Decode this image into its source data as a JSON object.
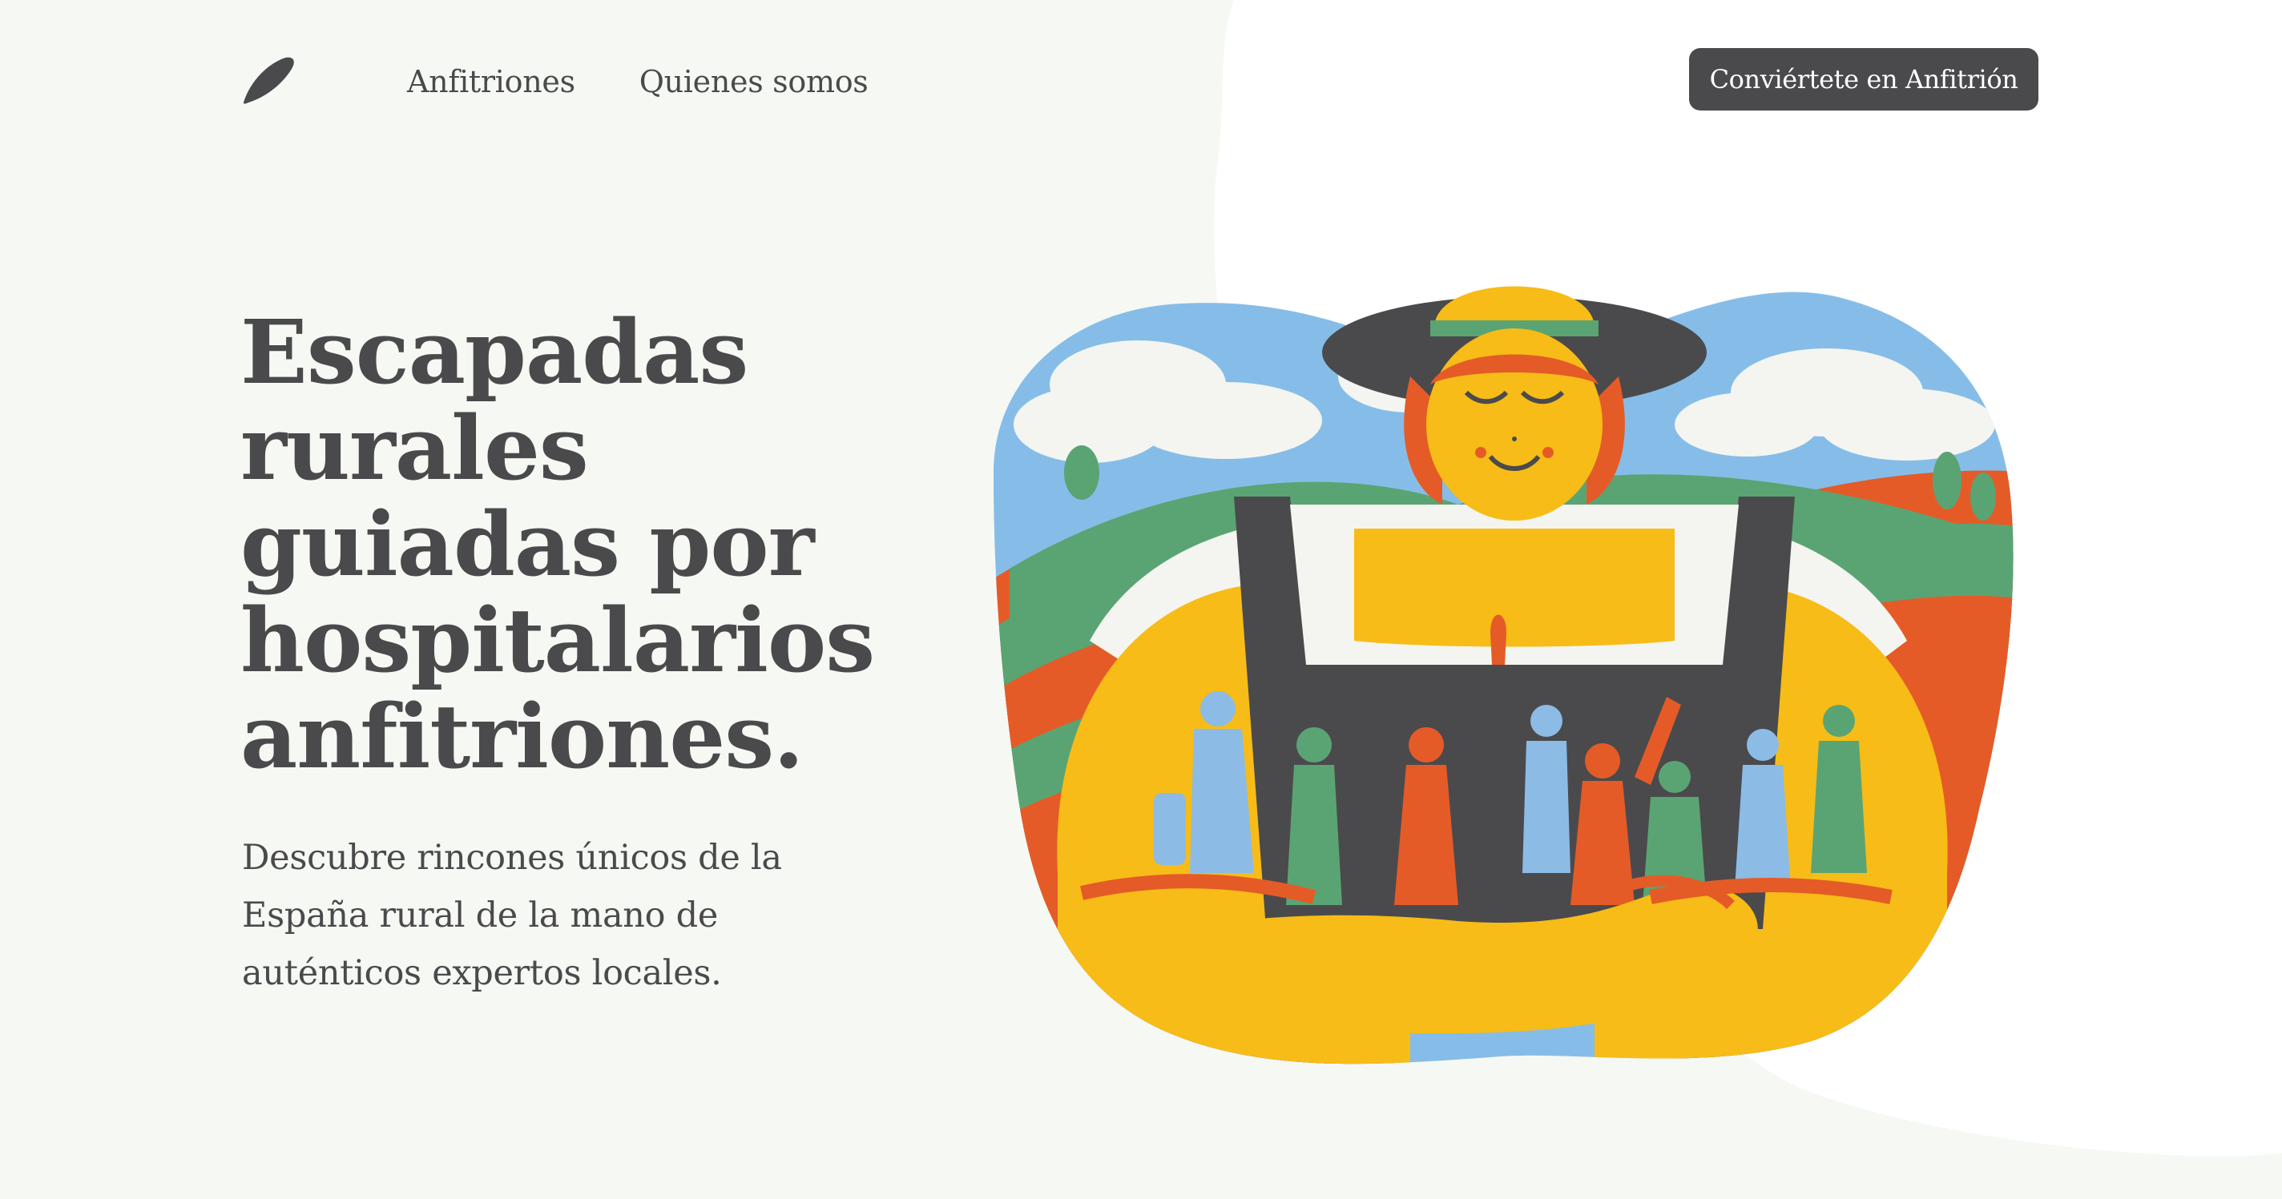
{
  "header": {
    "logo_icon": "feather-leaf-icon",
    "nav": [
      {
        "label": "Anfitriones"
      },
      {
        "label": "Quienes somos"
      }
    ],
    "cta_label": "Conviértete en Anfitrión"
  },
  "hero": {
    "title": "Escapadas rurales guiadas por hospitalarios anfitriones.",
    "subtitle": "Descubre rincones únicos de la España rural de la mano de auténticos expertos locales."
  },
  "illustration": {
    "icon": "rural-host-illustration",
    "colors": {
      "sky": "#86bde8",
      "yellow": "#f7bc17",
      "orange": "#e55b27",
      "green": "#5aa473",
      "dark": "#4a4a4c",
      "cloud": "#f4f5f0",
      "blue_figure": "#8cbbe6"
    }
  },
  "colors": {
    "page_bg": "#f6f8f3",
    "white_blob": "#ffffff",
    "text": "#4a4a4c",
    "button_bg": "#4a4a4c",
    "button_text": "#ffffff"
  }
}
